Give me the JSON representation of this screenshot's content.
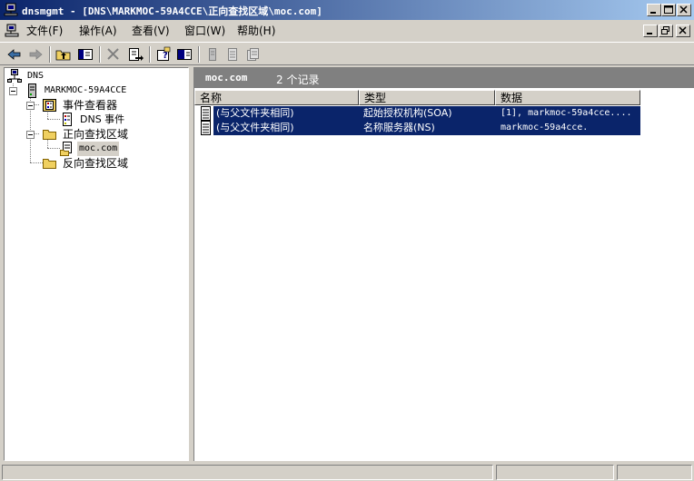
{
  "window": {
    "title": "dnsmgmt - [DNS\\MARKMOC-59A4CCE\\正向查找区域\\moc.com]"
  },
  "menu": {
    "items": [
      {
        "label": "文件(F)"
      },
      {
        "label": "操作(A)"
      },
      {
        "label": "查看(V)"
      },
      {
        "label": "窗口(W)"
      },
      {
        "label": "帮助(H)"
      }
    ]
  },
  "tree": {
    "root": "DNS",
    "server": "MARKMOC-59A4CCE",
    "event_viewer": "事件查看器",
    "dns_events": "DNS 事件",
    "forward_zones": "正向查找区域",
    "zone": "moc.com",
    "reverse_zones": "反向查找区域"
  },
  "right_pane": {
    "zone_name": "moc.com",
    "record_count": "2 个记录",
    "columns": [
      "名称",
      "类型",
      "数据"
    ],
    "rows": [
      {
        "name": "(与父文件夹相同)",
        "type": "起始授权机构(SOA)",
        "data": "[1], markmoc-59a4cce...."
      },
      {
        "name": "(与父文件夹相同)",
        "type": "名称服务器(NS)",
        "data": "markmoc-59a4cce."
      }
    ]
  },
  "colors": {
    "title_bar_start": "#0a246a",
    "title_bar_end": "#a6caf0",
    "selection": "#0a246a",
    "chrome": "#d4d0c8"
  },
  "icons": [
    "dns-app-icon",
    "back-icon",
    "forward-icon",
    "up-folder-icon",
    "show-hide-tree-icon",
    "delete-icon",
    "export-list-icon",
    "properties-icon",
    "help-icon",
    "new-record-icon",
    "minimize-icon",
    "restore-icon",
    "close-icon",
    "folder-icon",
    "server-icon",
    "record-icon"
  ]
}
